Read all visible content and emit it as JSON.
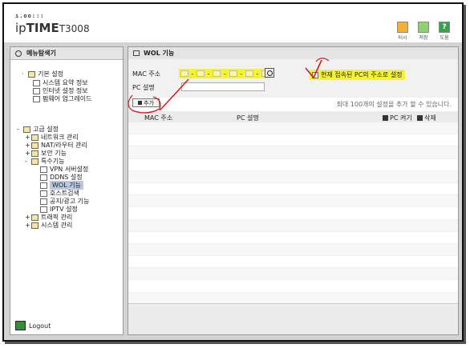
{
  "header": {
    "logo_dots": "ı.oo:::",
    "logo_prefix": "ip",
    "logo_bold": "TIME",
    "logo_model": "T3008",
    "icons": [
      {
        "name": "home-icon",
        "label": "터시"
      },
      {
        "name": "save-icon",
        "label": "저장"
      },
      {
        "name": "help-icon",
        "label": "도움",
        "glyph": "?"
      }
    ]
  },
  "sidebar": {
    "title": "메뉴탐색기",
    "basic": {
      "label": "기본 설정",
      "items": [
        "시스템 요약 정보",
        "인터넷 설정 정보",
        "펌웨어 업그레이드"
      ]
    },
    "advanced": {
      "label": "고급 설정",
      "groups": [
        {
          "label": "네트워크 관리",
          "sign": "+"
        },
        {
          "label": "NAT/라우터 관리",
          "sign": "+"
        },
        {
          "label": "보안 기능",
          "sign": "+"
        },
        {
          "label": "특수기능",
          "sign": "-"
        }
      ],
      "special_items": [
        "VPN 서버설정",
        "DDNS 설정",
        "WOL 기능",
        "호스트검색",
        "공지/광고 기능",
        "IPTV 설정"
      ],
      "selected": "WOL 기능",
      "tail_groups": [
        {
          "label": "트래픽 관리",
          "sign": "+"
        },
        {
          "label": "시스템 관리",
          "sign": "+"
        }
      ]
    },
    "logout": "Logout"
  },
  "main": {
    "title": "WOL 기능",
    "mac_label": "MAC 주소",
    "mac_separators": [
      "-",
      "-",
      "-",
      "-",
      "-"
    ],
    "current_pc_label": "현재 접속된 PC의 주소로 설정",
    "pc_name_label": "PC 설명",
    "pc_name_value": "",
    "add_button": "추가",
    "hint": "최대 100개의 설정을 추가 할 수 있습니다.",
    "columns": [
      "MAC 주소",
      "PC 설명"
    ],
    "actions": [
      "PC 켜기",
      "삭제"
    ]
  },
  "colors": {
    "highlight": "#f5f234",
    "annotation": "#d41a1a",
    "selected": "#bcc6e0"
  }
}
